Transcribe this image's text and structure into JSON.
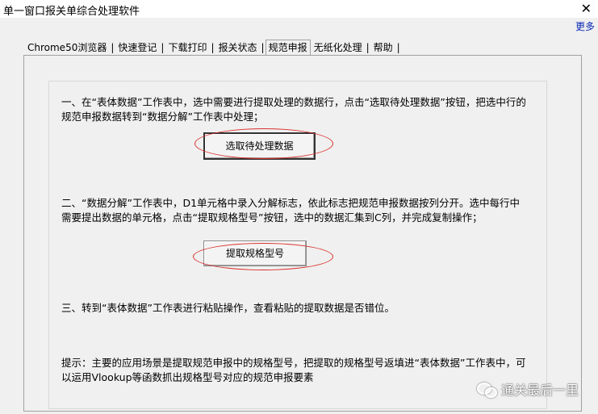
{
  "window": {
    "title": "单一窗口报关单综合处理软件",
    "close_glyph": "✕"
  },
  "more_link": "更多",
  "tabs": [
    {
      "label": "Chrome50浏览器"
    },
    {
      "label": "快速登记"
    },
    {
      "label": "下载打印"
    },
    {
      "label": "报关状态"
    },
    {
      "label": "规范申报",
      "active": true
    },
    {
      "label": "无纸化处理"
    },
    {
      "label": "帮助"
    }
  ],
  "steps": {
    "step1": "一、在“表体数据”工作表中，选中需要进行提取处理的数据行，点击“选取待处理数据”按钮，把选中行的规范申报数据转到“数据分解”工作表中处理；",
    "step2": "二、“数据分解”工作表中，D1单元格中录入分解标志，依此标志把规范申报数据按列分开。选中每行中需要提出数据的单元格，点击“提取规格型号”按钮，选中的数据汇集到C列，并完成复制操作；",
    "step3": "三、转到“表体数据”工作表进行粘贴操作，查看粘贴的提取数据是否错位。",
    "tip": "提示：主要的应用场景是提取规范申报中的规格型号，把提取的规格型号返填进“表体数据”工作表中，可以运用Vlookup等函数抓出规格型号对应的规范申报要素"
  },
  "buttons": {
    "select_data": "选取待处理数据",
    "extract_model": "提取规格型号"
  },
  "watermark": {
    "text": "通关最后一里",
    "icon": "wechat-icon"
  },
  "colors": {
    "highlight_ring": "#d9302b",
    "link": "#0a28b4"
  }
}
